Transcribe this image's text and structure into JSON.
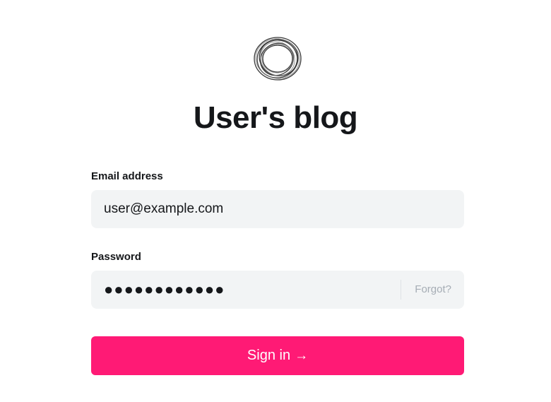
{
  "logo": {
    "icon": "ring-logo-icon"
  },
  "page": {
    "title": "User's blog"
  },
  "form": {
    "email": {
      "label": "Email address",
      "value": "user@example.com"
    },
    "password": {
      "label": "Password",
      "masked_value": "●●●●●●●●●●●●",
      "forgot_label": "Forgot?"
    },
    "submit": {
      "label": "Sign in",
      "arrow": "→"
    }
  },
  "colors": {
    "accent": "#ff1a75",
    "field_bg": "#f2f4f5",
    "text": "#15171a",
    "muted": "#a6adb5"
  }
}
